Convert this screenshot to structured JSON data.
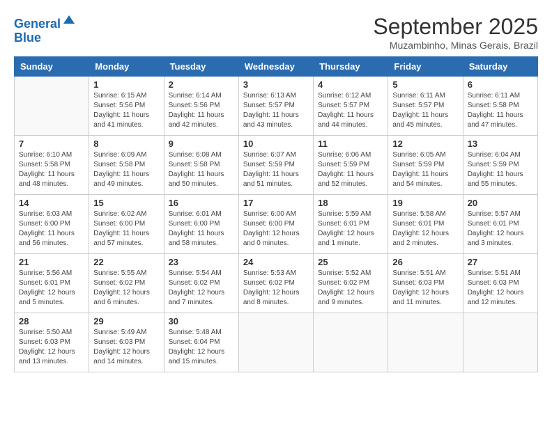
{
  "logo": {
    "line1": "General",
    "line2": "Blue"
  },
  "header": {
    "month": "September 2025",
    "location": "Muzambinho, Minas Gerais, Brazil"
  },
  "weekdays": [
    "Sunday",
    "Monday",
    "Tuesday",
    "Wednesday",
    "Thursday",
    "Friday",
    "Saturday"
  ],
  "weeks": [
    [
      {
        "day": "",
        "info": ""
      },
      {
        "day": "1",
        "info": "Sunrise: 6:15 AM\nSunset: 5:56 PM\nDaylight: 11 hours\nand 41 minutes."
      },
      {
        "day": "2",
        "info": "Sunrise: 6:14 AM\nSunset: 5:56 PM\nDaylight: 11 hours\nand 42 minutes."
      },
      {
        "day": "3",
        "info": "Sunrise: 6:13 AM\nSunset: 5:57 PM\nDaylight: 11 hours\nand 43 minutes."
      },
      {
        "day": "4",
        "info": "Sunrise: 6:12 AM\nSunset: 5:57 PM\nDaylight: 11 hours\nand 44 minutes."
      },
      {
        "day": "5",
        "info": "Sunrise: 6:11 AM\nSunset: 5:57 PM\nDaylight: 11 hours\nand 45 minutes."
      },
      {
        "day": "6",
        "info": "Sunrise: 6:11 AM\nSunset: 5:58 PM\nDaylight: 11 hours\nand 47 minutes."
      }
    ],
    [
      {
        "day": "7",
        "info": "Sunrise: 6:10 AM\nSunset: 5:58 PM\nDaylight: 11 hours\nand 48 minutes."
      },
      {
        "day": "8",
        "info": "Sunrise: 6:09 AM\nSunset: 5:58 PM\nDaylight: 11 hours\nand 49 minutes."
      },
      {
        "day": "9",
        "info": "Sunrise: 6:08 AM\nSunset: 5:58 PM\nDaylight: 11 hours\nand 50 minutes."
      },
      {
        "day": "10",
        "info": "Sunrise: 6:07 AM\nSunset: 5:59 PM\nDaylight: 11 hours\nand 51 minutes."
      },
      {
        "day": "11",
        "info": "Sunrise: 6:06 AM\nSunset: 5:59 PM\nDaylight: 11 hours\nand 52 minutes."
      },
      {
        "day": "12",
        "info": "Sunrise: 6:05 AM\nSunset: 5:59 PM\nDaylight: 11 hours\nand 54 minutes."
      },
      {
        "day": "13",
        "info": "Sunrise: 6:04 AM\nSunset: 5:59 PM\nDaylight: 11 hours\nand 55 minutes."
      }
    ],
    [
      {
        "day": "14",
        "info": "Sunrise: 6:03 AM\nSunset: 6:00 PM\nDaylight: 11 hours\nand 56 minutes."
      },
      {
        "day": "15",
        "info": "Sunrise: 6:02 AM\nSunset: 6:00 PM\nDaylight: 11 hours\nand 57 minutes."
      },
      {
        "day": "16",
        "info": "Sunrise: 6:01 AM\nSunset: 6:00 PM\nDaylight: 11 hours\nand 58 minutes."
      },
      {
        "day": "17",
        "info": "Sunrise: 6:00 AM\nSunset: 6:00 PM\nDaylight: 12 hours\nand 0 minutes."
      },
      {
        "day": "18",
        "info": "Sunrise: 5:59 AM\nSunset: 6:01 PM\nDaylight: 12 hours\nand 1 minute."
      },
      {
        "day": "19",
        "info": "Sunrise: 5:58 AM\nSunset: 6:01 PM\nDaylight: 12 hours\nand 2 minutes."
      },
      {
        "day": "20",
        "info": "Sunrise: 5:57 AM\nSunset: 6:01 PM\nDaylight: 12 hours\nand 3 minutes."
      }
    ],
    [
      {
        "day": "21",
        "info": "Sunrise: 5:56 AM\nSunset: 6:01 PM\nDaylight: 12 hours\nand 5 minutes."
      },
      {
        "day": "22",
        "info": "Sunrise: 5:55 AM\nSunset: 6:02 PM\nDaylight: 12 hours\nand 6 minutes."
      },
      {
        "day": "23",
        "info": "Sunrise: 5:54 AM\nSunset: 6:02 PM\nDaylight: 12 hours\nand 7 minutes."
      },
      {
        "day": "24",
        "info": "Sunrise: 5:53 AM\nSunset: 6:02 PM\nDaylight: 12 hours\nand 8 minutes."
      },
      {
        "day": "25",
        "info": "Sunrise: 5:52 AM\nSunset: 6:02 PM\nDaylight: 12 hours\nand 9 minutes."
      },
      {
        "day": "26",
        "info": "Sunrise: 5:51 AM\nSunset: 6:03 PM\nDaylight: 12 hours\nand 11 minutes."
      },
      {
        "day": "27",
        "info": "Sunrise: 5:51 AM\nSunset: 6:03 PM\nDaylight: 12 hours\nand 12 minutes."
      }
    ],
    [
      {
        "day": "28",
        "info": "Sunrise: 5:50 AM\nSunset: 6:03 PM\nDaylight: 12 hours\nand 13 minutes."
      },
      {
        "day": "29",
        "info": "Sunrise: 5:49 AM\nSunset: 6:03 PM\nDaylight: 12 hours\nand 14 minutes."
      },
      {
        "day": "30",
        "info": "Sunrise: 5:48 AM\nSunset: 6:04 PM\nDaylight: 12 hours\nand 15 minutes."
      },
      {
        "day": "",
        "info": ""
      },
      {
        "day": "",
        "info": ""
      },
      {
        "day": "",
        "info": ""
      },
      {
        "day": "",
        "info": ""
      }
    ]
  ]
}
